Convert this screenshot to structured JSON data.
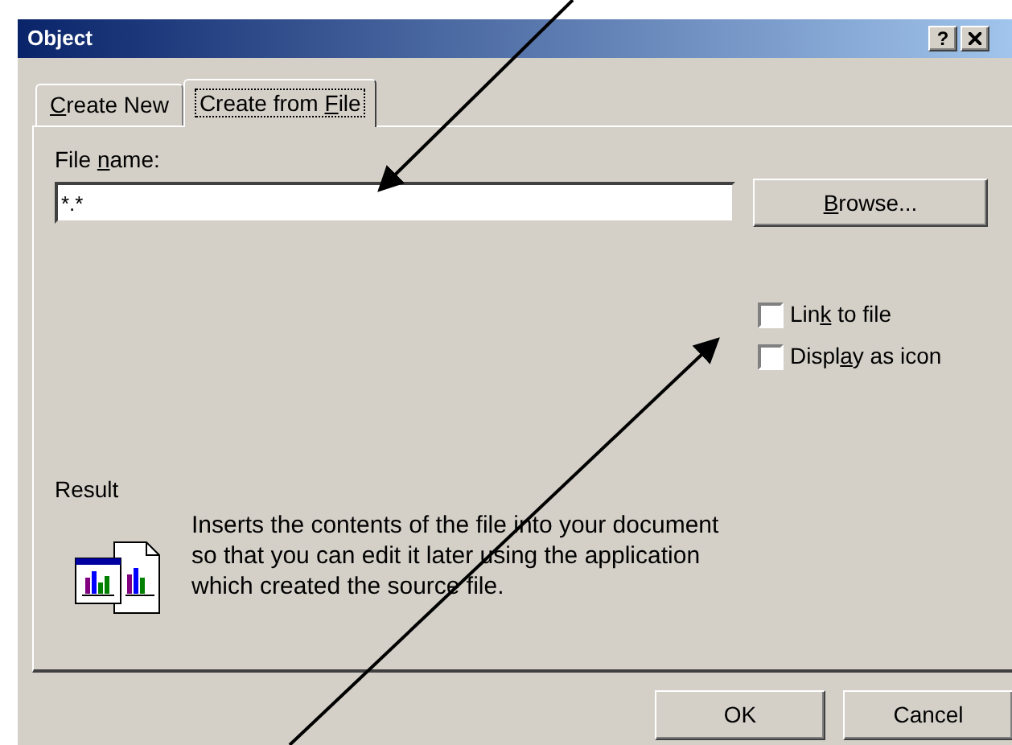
{
  "window": {
    "title": "Object",
    "help_button": "?"
  },
  "tabs": [
    {
      "key": "C",
      "rest": "reate New",
      "selected": false
    },
    {
      "start": "Create from ",
      "key": "F",
      "rest": "ile",
      "selected": true
    }
  ],
  "file_name": {
    "label": {
      "start": "File ",
      "key": "n",
      "rest": "ame:"
    },
    "value": "*.*"
  },
  "browse_button": {
    "key": "B",
    "rest": "rowse..."
  },
  "options": [
    {
      "start": "Lin",
      "key": "k",
      "rest": " to file",
      "checked": false
    },
    {
      "start": "Displ",
      "key": "a",
      "rest": "y as icon",
      "checked": false
    }
  ],
  "result": {
    "label": "Result",
    "text": "Inserts the contents of the file into your document so that you can edit it later using the application which created the source file."
  },
  "buttons": [
    {
      "label": "OK"
    },
    {
      "label": "Cancel"
    }
  ]
}
